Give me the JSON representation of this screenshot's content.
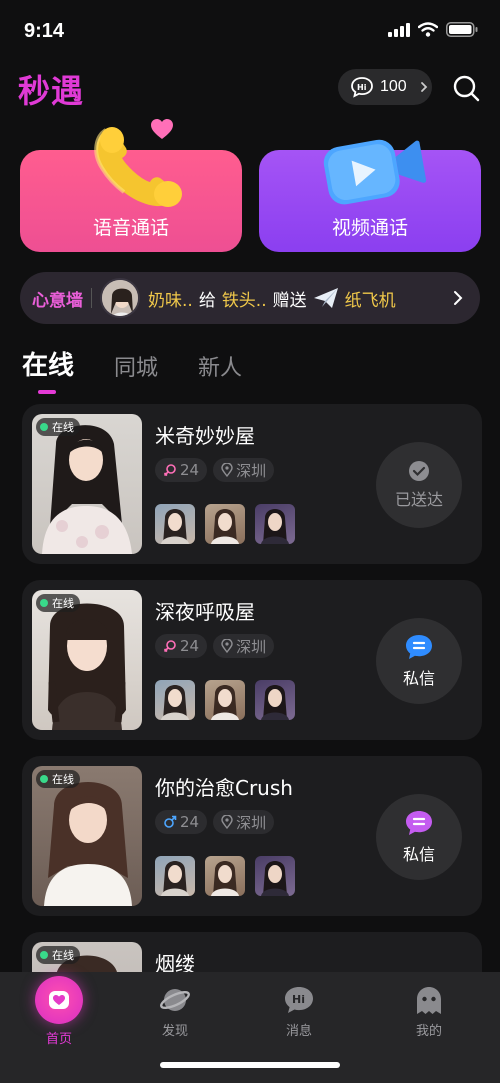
{
  "status_bar": {
    "time": "9:14"
  },
  "header": {
    "logo": "秒遇",
    "coin_icon": "hi-bubble-icon",
    "coin_count": "100"
  },
  "calls": {
    "voice_label": "语音通话",
    "video_label": "视频通话"
  },
  "wish_wall": {
    "title": "心意墙",
    "sender": "奶味..",
    "verb": "给",
    "receiver": "铁头..",
    "action": "赠送",
    "gift": "纸飞机"
  },
  "tabs": [
    "在线",
    "同城",
    "新人"
  ],
  "online_label": "在线",
  "users": [
    {
      "name": "米奇妙妙屋",
      "gender": "female",
      "age": "24",
      "city": "深圳",
      "action": "已送达",
      "action_state": "sent"
    },
    {
      "name": "深夜呼吸屋",
      "gender": "female",
      "age": "24",
      "city": "深圳",
      "action": "私信",
      "action_state": "message"
    },
    {
      "name": "你的治愈Crush",
      "gender": "male",
      "age": "24",
      "city": "深圳",
      "action": "私信",
      "action_state": "message"
    },
    {
      "name": "烟缕",
      "gender": "female",
      "age": "",
      "city": "",
      "action": "",
      "action_state": ""
    }
  ],
  "nav": [
    {
      "label": "首页",
      "icon": "heart-home-icon",
      "active": true
    },
    {
      "label": "发现",
      "icon": "planet-icon",
      "active": false
    },
    {
      "label": "消息",
      "icon": "hi-chat-icon",
      "active": false
    },
    {
      "label": "我的",
      "icon": "ghost-profile-icon",
      "active": false
    }
  ],
  "colors": {
    "accent": "#e43ad6",
    "voice_card": "#ff5d8f",
    "video_card": "#a554f5",
    "gold": "#f0c84a",
    "online": "#39d98a"
  }
}
